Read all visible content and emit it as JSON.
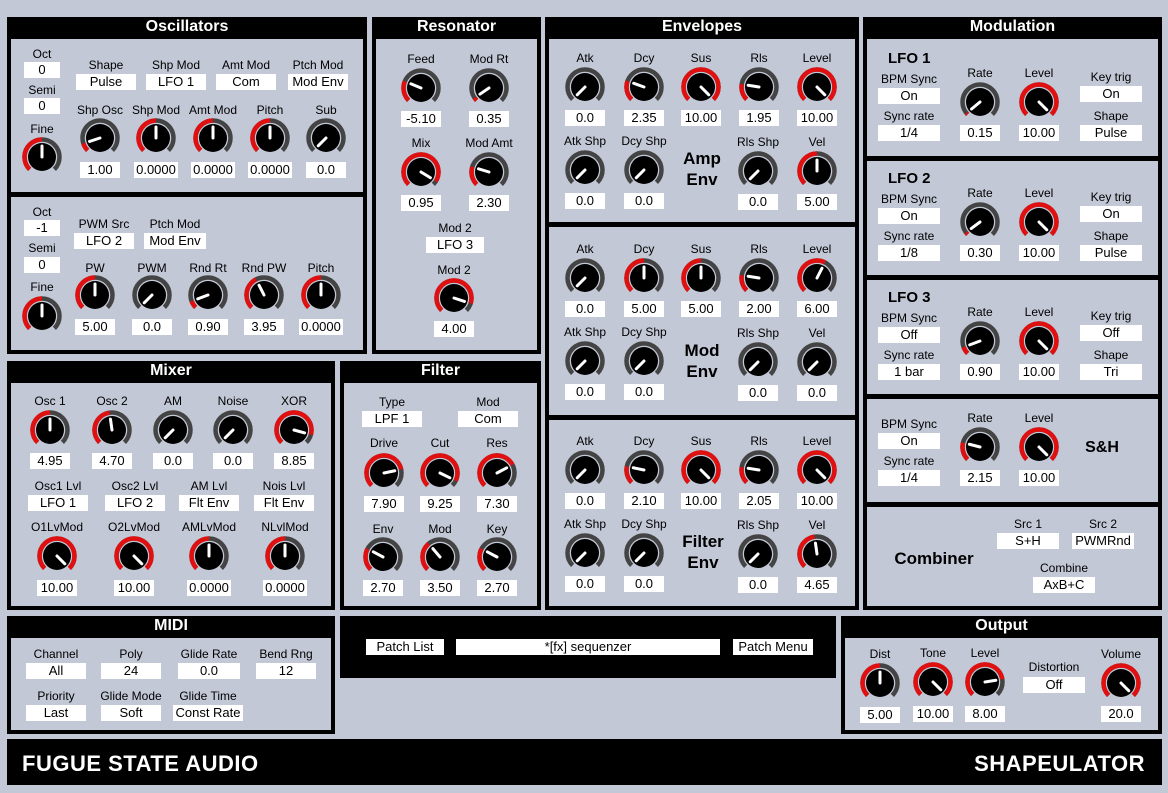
{
  "colors": {
    "panel": "#000000",
    "bg": "#c3c8d6",
    "arc": "#e01010",
    "track": "#444444"
  },
  "osc": {
    "title": "Oscillators",
    "oct_label": "Oct",
    "oct_val": "0",
    "semi_label": "Semi",
    "semi_val": "0",
    "fine_label": "Fine",
    "shape_label": "Shape",
    "shape_val": "Pulse",
    "shpmod_label": "Shp Mod",
    "shpmod_val": "LFO 1",
    "amtmod_label": "Amt Mod",
    "amtmod_val": "Com",
    "ptchmod_label": "Ptch Mod",
    "ptchmod_val": "Mod Env",
    "k_shposc": "Shp Osc",
    "v_shposc": "1.00",
    "k_shpmod": "Shp Mod",
    "v_shpmod": "0.0000",
    "k_amtmod": "Amt Mod",
    "v_amtmod": "0.0000",
    "k_pitch": "Pitch",
    "v_pitch": "0.0000",
    "k_sub": "Sub",
    "v_sub": "0.0",
    "oct2_label": "Oct",
    "oct2_val": "-1",
    "semi2_label": "Semi",
    "semi2_val": "0",
    "fine2_label": "Fine",
    "pwmsrc_label": "PWM Src",
    "pwmsrc_val": "LFO 2",
    "ptchmod2_label": "Ptch Mod",
    "ptchmod2_val": "Mod Env",
    "k_pw": "PW",
    "v_pw": "5.00",
    "k_pwm": "PWM",
    "v_pwm": "0.0",
    "k_rndrt": "Rnd Rt",
    "v_rndrt": "0.90",
    "k_rndpw": "Rnd PW",
    "v_rndpw": "3.95",
    "k_pitch2": "Pitch",
    "v_pitch2": "0.0000"
  },
  "res": {
    "title": "Resonator",
    "k_feed": "Feed",
    "v_feed": "-5.10",
    "k_modrt": "Mod Rt",
    "v_modrt": "0.35",
    "k_mix": "Mix",
    "v_mix": "0.95",
    "k_modamt": "Mod Amt",
    "v_modamt": "2.30",
    "mod2_label": "Mod 2",
    "mod2_val": "LFO 3",
    "k_mod2": "Mod 2",
    "v_mod2": "4.00"
  },
  "env": {
    "title": "Envelopes",
    "amp": {
      "name1": "Amp",
      "name2": "Env",
      "atk": "Atk",
      "dcy": "Dcy",
      "sus": "Sus",
      "rls": "Rls",
      "level": "Level",
      "atkshp": "Atk Shp",
      "dcyshp": "Dcy Shp",
      "rlsshp": "Rls Shp",
      "vel": "Vel",
      "v_atk": "0.0",
      "v_dcy": "2.35",
      "v_sus": "10.00",
      "v_rls": "1.95",
      "v_level": "10.00",
      "v_atkshp": "0.0",
      "v_dcyshp": "0.0",
      "v_rlsshp": "0.0",
      "v_vel": "5.00"
    },
    "mod": {
      "name1": "Mod",
      "name2": "Env",
      "atk": "Atk",
      "dcy": "Dcy",
      "sus": "Sus",
      "rls": "Rls",
      "level": "Level",
      "atkshp": "Atk Shp",
      "dcyshp": "Dcy Shp",
      "rlsshp": "Rls Shp",
      "vel": "Vel",
      "v_atk": "0.0",
      "v_dcy": "5.00",
      "v_sus": "5.00",
      "v_rls": "2.00",
      "v_level": "6.00",
      "v_atkshp": "0.0",
      "v_dcyshp": "0.0",
      "v_rlsshp": "0.0",
      "v_vel": "0.0"
    },
    "filt": {
      "name1": "Filter",
      "name2": "Env",
      "atk": "Atk",
      "dcy": "Dcy",
      "sus": "Sus",
      "rls": "Rls",
      "level": "Level",
      "atkshp": "Atk Shp",
      "dcyshp": "Dcy Shp",
      "rlsshp": "Rls Shp",
      "vel": "Vel",
      "v_atk": "0.0",
      "v_dcy": "2.10",
      "v_sus": "10.00",
      "v_rls": "2.05",
      "v_level": "10.00",
      "v_atkshp": "0.0",
      "v_dcyshp": "0.0",
      "v_rlsshp": "0.0",
      "v_vel": "4.65"
    }
  },
  "modu": {
    "title": "Modulation",
    "lfo1": {
      "name": "LFO 1",
      "bpm_label": "BPM Sync",
      "bpm_val": "On",
      "sync_label": "Sync rate",
      "sync_val": "1/4",
      "k_rate": "Rate",
      "v_rate": "0.15",
      "k_level": "Level",
      "v_level": "10.00",
      "keytrig_label": "Key trig",
      "keytrig_val": "On",
      "shape_label": "Shape",
      "shape_val": "Pulse"
    },
    "lfo2": {
      "name": "LFO 2",
      "bpm_label": "BPM Sync",
      "bpm_val": "On",
      "sync_label": "Sync rate",
      "sync_val": "1/8",
      "k_rate": "Rate",
      "v_rate": "0.30",
      "k_level": "Level",
      "v_level": "10.00",
      "keytrig_label": "Key trig",
      "keytrig_val": "On",
      "shape_label": "Shape",
      "shape_val": "Pulse"
    },
    "lfo3": {
      "name": "LFO 3",
      "bpm_label": "BPM Sync",
      "bpm_val": "Off",
      "sync_label": "Sync rate",
      "sync_val": "1 bar",
      "k_rate": "Rate",
      "v_rate": "0.90",
      "k_level": "Level",
      "v_level": "10.00",
      "keytrig_label": "Key trig",
      "keytrig_val": "Off",
      "shape_label": "Shape",
      "shape_val": "Tri"
    },
    "sh": {
      "name": "S&H",
      "bpm_label": "BPM Sync",
      "bpm_val": "On",
      "sync_label": "Sync rate",
      "sync_val": "1/4",
      "k_rate": "Rate",
      "v_rate": "2.15",
      "k_level": "Level",
      "v_level": "10.00"
    },
    "comb": {
      "name": "Combiner",
      "src1_label": "Src 1",
      "src1_val": "S+H",
      "src2_label": "Src 2",
      "src2_val": "PWMRnd",
      "combine_label": "Combine",
      "combine_val": "AxB+C"
    }
  },
  "mixer": {
    "title": "Mixer",
    "k_osc1": "Osc 1",
    "v_osc1": "4.95",
    "k_osc2": "Osc 2",
    "v_osc2": "4.70",
    "k_am": "AM",
    "v_am": "0.0",
    "k_noise": "Noise",
    "v_noise": "0.0",
    "k_xor": "XOR",
    "v_xor": "8.85",
    "osc1lvl_label": "Osc1 Lvl",
    "osc1lvl_val": "LFO 1",
    "osc2lvl_label": "Osc2 Lvl",
    "osc2lvl_val": "LFO 2",
    "amlvl_label": "AM Lvl",
    "amlvl_val": "Flt Env",
    "noislvl_label": "Nois Lvl",
    "noislvl_val": "Flt Env",
    "k_o1lvmod": "O1LvMod",
    "v_o1lvmod": "10.00",
    "k_o2lvmod": "O2LvMod",
    "v_o2lvmod": "10.00",
    "k_amlvmod": "AMLvMod",
    "v_amlvmod": "0.0000",
    "k_nlvlmod": "NLvlMod",
    "v_nlvlmod": "0.0000"
  },
  "filter": {
    "title": "Filter",
    "type_label": "Type",
    "type_val": "LPF 1",
    "mod_label": "Mod",
    "mod_val": "Com",
    "k_drive": "Drive",
    "v_drive": "7.90",
    "k_cut": "Cut",
    "v_cut": "9.25",
    "k_res": "Res",
    "v_res": "7.30",
    "k_env": "Env",
    "v_env": "2.70",
    "k_mod": "Mod",
    "v_mod": "3.50",
    "k_key": "Key",
    "v_key": "2.70"
  },
  "midi": {
    "title": "MIDI",
    "channel_label": "Channel",
    "channel_val": "All",
    "poly_label": "Poly",
    "poly_val": "24",
    "gliderate_label": "Glide Rate",
    "gliderate_val": "0.0",
    "bendrng_label": "Bend Rng",
    "bendrng_val": "12",
    "priority_label": "Priority",
    "priority_val": "Last",
    "glidemode_label": "Glide Mode",
    "glidemode_val": "Soft",
    "glidetime_label": "Glide Time",
    "glidetime_val": "Const Rate"
  },
  "patch": {
    "list_btn": "Patch List",
    "name": "*[fx] sequenzer",
    "menu_btn": "Patch Menu"
  },
  "output": {
    "title": "Output",
    "k_dist": "Dist",
    "v_dist": "5.00",
    "k_tone": "Tone",
    "v_tone": "10.00",
    "k_level": "Level",
    "v_level": "8.00",
    "distortion_label": "Distortion",
    "distortion_val": "Off",
    "k_volume": "Volume",
    "v_volume": "20.0"
  },
  "footer": {
    "brand": "FUGUE STATE AUDIO",
    "product": "SHAPEULATOR"
  },
  "knob_levels": {
    "osc_fine": 0.5,
    "osc_shposc": 0.1,
    "osc_shpmod": 0.5,
    "osc_amtmod": 0.5,
    "osc_pitch": 0.5,
    "osc_sub": 0,
    "osc_fine2": 0.5,
    "osc_pw": 0.5,
    "osc_pwm": 0,
    "osc_rndrt": 0.09,
    "osc_rndpw": 0.4,
    "osc_pitch2": 0.5,
    "res_feed": 0.25,
    "res_modrt": 0.04,
    "res_mix": 0.95,
    "res_modamt": 0.23,
    "res_mod2": 0.9,
    "amp_atk": 0,
    "amp_dcy": 0.24,
    "amp_sus": 1,
    "amp_rls": 0.2,
    "amp_level": 1,
    "amp_atkshp": 0,
    "amp_dcyshp": 0,
    "amp_rlsshp": 0,
    "amp_vel": 0.5,
    "mod_atk": 0,
    "mod_dcy": 0.5,
    "mod_sus": 0.5,
    "mod_rls": 0.2,
    "mod_level": 0.6,
    "mod_atkshp": 0,
    "mod_dcyshp": 0,
    "mod_rlsshp": 0,
    "mod_vel": 0,
    "filt_atk": 0,
    "filt_dcy": 0.21,
    "filt_sus": 1,
    "filt_rls": 0.2,
    "filt_level": 1,
    "filt_atkshp": 0,
    "filt_dcyshp": 0,
    "filt_rlsshp": 0,
    "filt_vel": 0.47,
    "lfo1_rate": 0.02,
    "lfo1_level": 1,
    "lfo2_rate": 0.03,
    "lfo2_level": 1,
    "lfo3_rate": 0.09,
    "lfo3_level": 1,
    "sh_rate": 0.22,
    "sh_level": 1,
    "mix_osc1": 0.5,
    "mix_osc2": 0.47,
    "mix_am": 0,
    "mix_noise": 0,
    "mix_xor": 0.89,
    "mix_o1lvmod": 1,
    "mix_o2lvmod": 1,
    "mix_amlvmod": 0.5,
    "mix_nlvlmod": 0.5,
    "fil_drive": 0.79,
    "fil_cut": 0.93,
    "fil_res": 0.73,
    "fil_env": 0.27,
    "fil_mod": 0.35,
    "fil_key": 0.27,
    "out_dist": 0.5,
    "out_tone": 1,
    "out_level": 0.8,
    "out_volume": 1
  }
}
